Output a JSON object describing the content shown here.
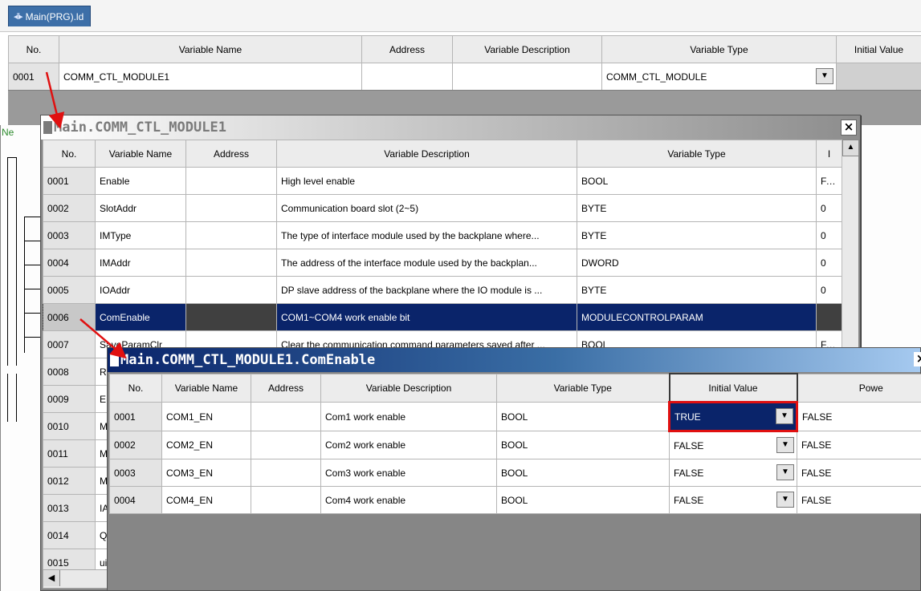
{
  "tab": {
    "label": "Main(PRG).ld",
    "icon": "ladder-program-icon"
  },
  "main_table": {
    "headers": [
      "No.",
      "Variable Name",
      "Address",
      "Variable Description",
      "Variable Type",
      "Initial Value"
    ],
    "rows": [
      {
        "no": "0001",
        "name": "COMM_CTL_MODULE1",
        "address": "",
        "description": "",
        "type": "COMM_CTL_MODULE"
      }
    ]
  },
  "under_text": "Ne",
  "popup1": {
    "title": "Main.COMM_CTL_MODULE1",
    "close_label": "×",
    "headers": [
      "No.",
      "Variable Name",
      "Address",
      "Variable Description",
      "Variable Type",
      "I"
    ],
    "rows": [
      {
        "no": "0001",
        "name": "Enable",
        "address": "",
        "description": "High level enable",
        "type": "BOOL",
        "initial": "FAL"
      },
      {
        "no": "0002",
        "name": "SlotAddr",
        "address": "",
        "description": "Communication board slot (2~5)",
        "type": "BYTE",
        "initial": "0"
      },
      {
        "no": "0003",
        "name": "IMType",
        "address": "",
        "description": "The type of interface module used by the backplane where...",
        "type": "BYTE",
        "initial": "0"
      },
      {
        "no": "0004",
        "name": "IMAddr",
        "address": "",
        "description": "The address of the interface module used by the backplan...",
        "type": "DWORD",
        "initial": "0"
      },
      {
        "no": "0005",
        "name": "IOAddr",
        "address": "",
        "description": "DP slave address of the backplane where the IO module is ...",
        "type": "BYTE",
        "initial": "0"
      },
      {
        "no": "0006",
        "name": "ComEnable",
        "address": "",
        "description": "COM1~COM4 work enable bit",
        "type": "MODULECONTROLPARAM",
        "initial": ""
      },
      {
        "no": "0007",
        "name": "SaveParamClr",
        "address": "",
        "description": "Clear the communication command parameters saved after ...",
        "type": "BOOL",
        "initial": "FAL"
      },
      {
        "no": "0008",
        "name": "R",
        "address": "",
        "description": "",
        "type": "",
        "initial": ""
      },
      {
        "no": "0009",
        "name": "E",
        "address": "",
        "description": "",
        "type": "",
        "initial": ""
      },
      {
        "no": "0010",
        "name": "M",
        "address": "",
        "description": "",
        "type": "",
        "initial": ""
      },
      {
        "no": "0011",
        "name": "M",
        "address": "",
        "description": "",
        "type": "",
        "initial": ""
      },
      {
        "no": "0012",
        "name": "M",
        "address": "",
        "description": "",
        "type": "",
        "initial": ""
      },
      {
        "no": "0013",
        "name": "IA",
        "address": "",
        "description": "",
        "type": "",
        "initial": ""
      },
      {
        "no": "0014",
        "name": "Q",
        "address": "",
        "description": "",
        "type": "",
        "initial": ""
      },
      {
        "no": "0015",
        "name": "ui",
        "address": "",
        "description": "",
        "type": "",
        "initial": ""
      }
    ]
  },
  "popup2": {
    "title": "Main.COMM_CTL_MODULE1.ComEnable",
    "close_label": "×",
    "headers": [
      "No.",
      "Variable Name",
      "Address",
      "Variable Description",
      "Variable Type",
      "Initial Value",
      "Powe"
    ],
    "rows": [
      {
        "no": "0001",
        "name": "COM1_EN",
        "address": "",
        "description": "Com1 work enable",
        "type": "BOOL",
        "initial": "TRUE",
        "power": "FALSE"
      },
      {
        "no": "0002",
        "name": "COM2_EN",
        "address": "",
        "description": "Com2 work enable",
        "type": "BOOL",
        "initial": "FALSE",
        "power": "FALSE"
      },
      {
        "no": "0003",
        "name": "COM3_EN",
        "address": "",
        "description": "Com3 work enable",
        "type": "BOOL",
        "initial": "FALSE",
        "power": "FALSE"
      },
      {
        "no": "0004",
        "name": "COM4_EN",
        "address": "",
        "description": "Com4 work enable",
        "type": "BOOL",
        "initial": "FALSE",
        "power": "FALSE"
      }
    ]
  },
  "colors": {
    "selection": "#0a246a",
    "annotation": "#e01010",
    "tab": "#3d6fa8"
  }
}
